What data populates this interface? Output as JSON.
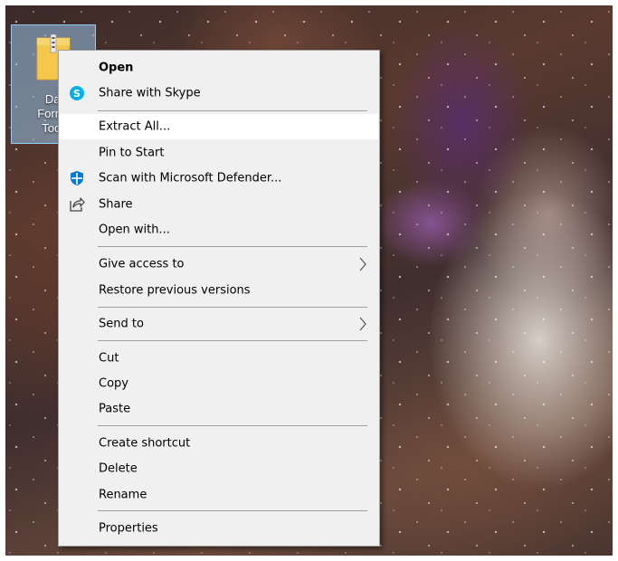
{
  "desktop": {
    "file": {
      "label_lines": [
        "Dat",
        "Forma",
        "Tool."
      ],
      "icon": "zip-folder-icon"
    }
  },
  "context_menu": {
    "items": [
      {
        "id": "open",
        "label": "Open",
        "bold": true
      },
      {
        "id": "share-with-skype",
        "label": "Share with Skype",
        "icon": "skype-icon"
      },
      {
        "id": "extract-all",
        "label": "Extract All...",
        "highlighted": true
      },
      {
        "id": "pin-to-start",
        "label": "Pin to Start"
      },
      {
        "id": "scan-defender",
        "label": "Scan with Microsoft Defender...",
        "icon": "defender-shield-icon"
      },
      {
        "id": "share",
        "label": "Share",
        "icon": "share-icon"
      },
      {
        "id": "open-with",
        "label": "Open with..."
      },
      {
        "id": "give-access-to",
        "label": "Give access to",
        "submenu": true
      },
      {
        "id": "restore-previous-versions",
        "label": "Restore previous versions"
      },
      {
        "id": "send-to",
        "label": "Send to",
        "submenu": true
      },
      {
        "id": "cut",
        "label": "Cut"
      },
      {
        "id": "copy",
        "label": "Copy"
      },
      {
        "id": "paste",
        "label": "Paste"
      },
      {
        "id": "create-shortcut",
        "label": "Create shortcut"
      },
      {
        "id": "delete",
        "label": "Delete"
      },
      {
        "id": "rename",
        "label": "Rename"
      },
      {
        "id": "properties",
        "label": "Properties"
      }
    ]
  },
  "colors": {
    "menu_background": "#f0f0f0",
    "highlight": "#ffffff",
    "separator": "#a0a0a0",
    "skype": "#00aff0",
    "defender": "#0078d7",
    "selection": "#99c4eb"
  }
}
